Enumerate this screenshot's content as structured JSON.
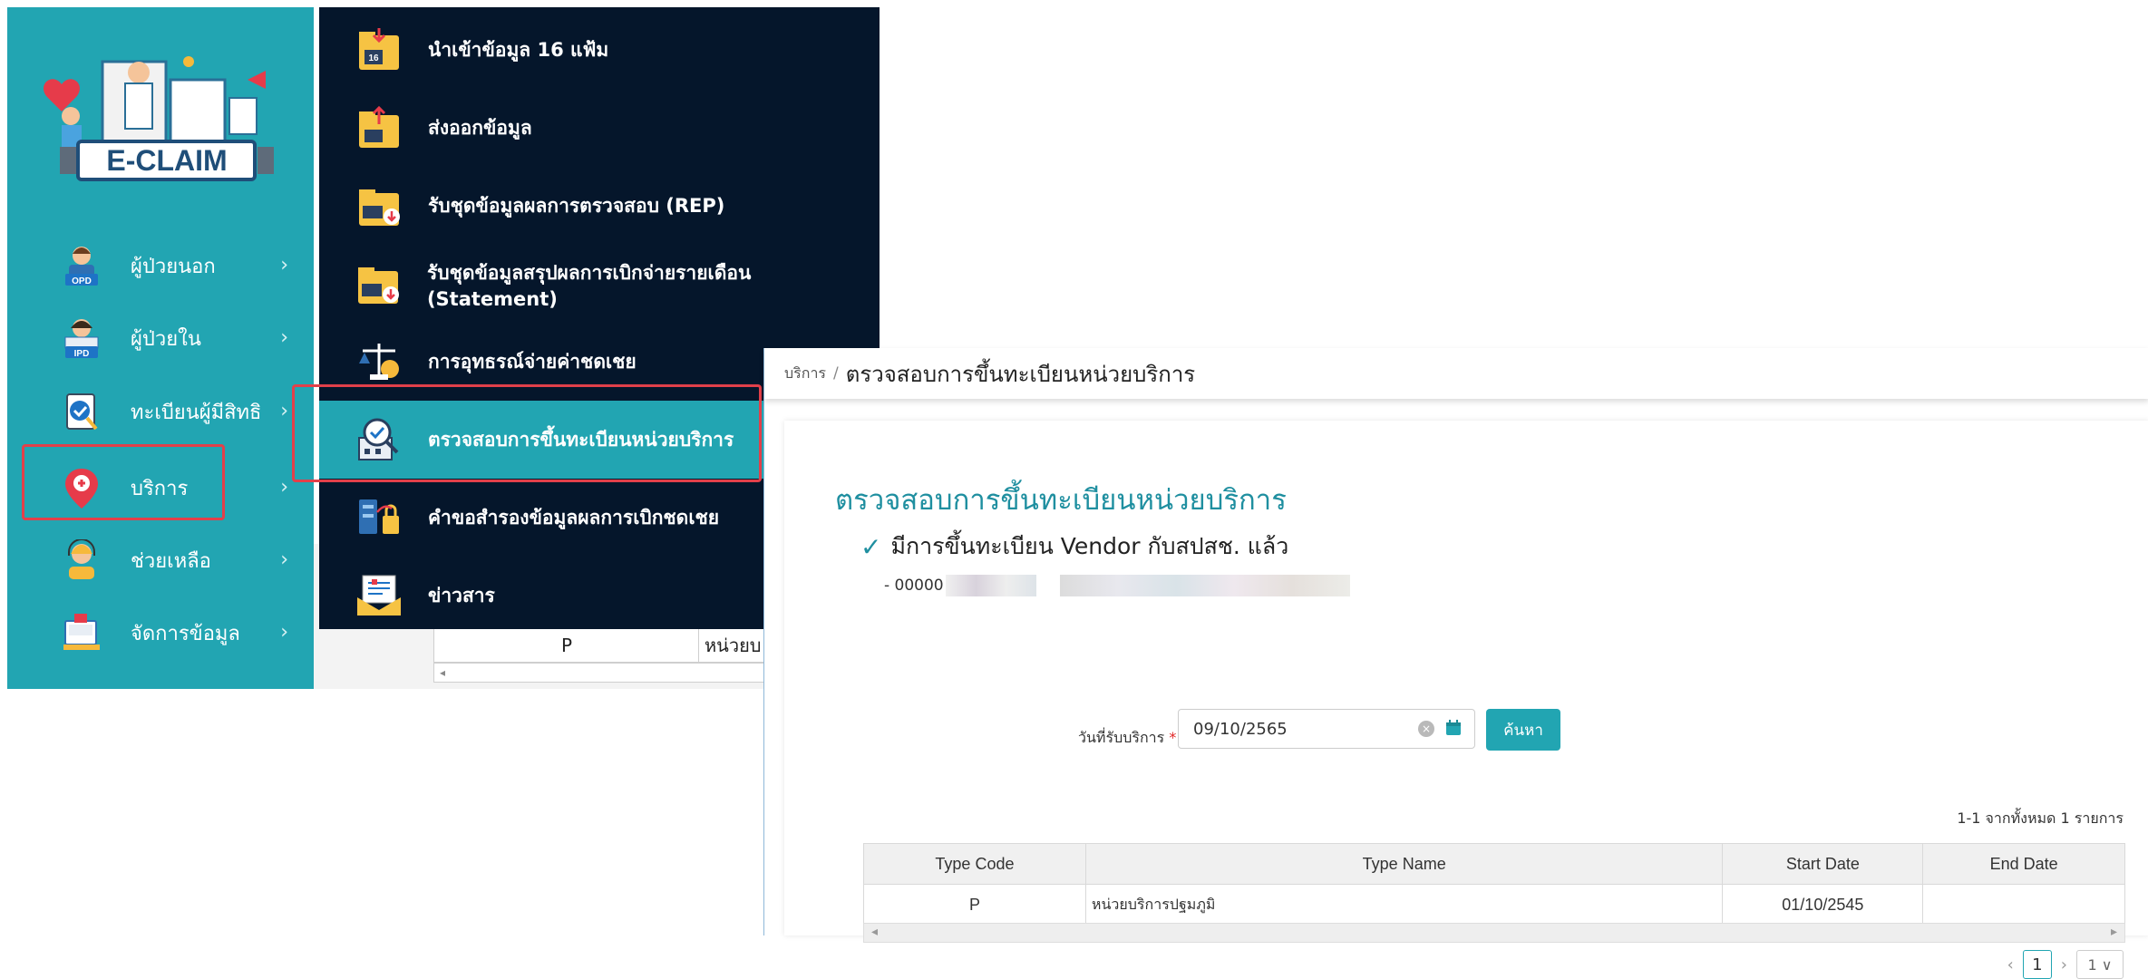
{
  "sidebar": {
    "logo_text": "E-CLAIM",
    "items": [
      {
        "label": "ผู้ป่วยนอก",
        "icon": "opd-patient-icon",
        "badge": "OPD"
      },
      {
        "label": "ผู้ป่วยใน",
        "icon": "ipd-patient-icon",
        "badge": "IPD"
      },
      {
        "label": "ทะเบียนผู้มีสิทธิ",
        "icon": "registry-check-icon"
      },
      {
        "label": "บริการ",
        "icon": "service-pin-icon"
      },
      {
        "label": "ช่วยเหลือ",
        "icon": "help-support-icon"
      },
      {
        "label": "จัดการข้อมูล",
        "icon": "data-manage-icon"
      }
    ],
    "chevron": "›"
  },
  "submenu": {
    "items": [
      {
        "label": "นำเข้าข้อมูล 16 แฟ้ม",
        "icon": "import-folder-icon",
        "badge": "16"
      },
      {
        "label": "ส่งออกข้อมูล",
        "icon": "export-folder-icon"
      },
      {
        "label": "รับชุดข้อมูลผลการตรวจสอบ (REP)",
        "icon": "rep-folder-icon"
      },
      {
        "label": "รับชุดข้อมูลสรุปผลการเบิกจ่ายรายเดือน (Statement)",
        "icon": "statement-folder-icon"
      },
      {
        "label": "การอุทธรณ์จ่ายค่าชดเชย",
        "icon": "scale-icon"
      },
      {
        "label": "ตรวจสอบการขึ้นทะเบียนหน่วยบริการ",
        "icon": "unit-check-icon"
      },
      {
        "label": "คำขอสำรองข้อมูลผลการเบิกชดเชย",
        "icon": "backup-request-icon"
      },
      {
        "label": "ข่าวสาร",
        "icon": "news-icon"
      }
    ]
  },
  "background": {
    "cell_code": "P",
    "cell_name": "หน่วยบ",
    "scroll_left": "◂"
  },
  "main": {
    "breadcrumb": {
      "parent": "บริการ",
      "separator": "/",
      "current": "ตรวจสอบการขึ้นทะเบียนหน่วยบริการ"
    },
    "title": "ตรวจสอบการขึ้นทะเบียนหน่วยบริการ",
    "status": {
      "check": "✓",
      "text": "มีการขึ้นทะเบียน Vendor กับสปสช. แล้ว"
    },
    "vendor_prefix": "- 00000",
    "date_field": {
      "label": "วันที่รับบริการ",
      "required": "*",
      "value": "09/10/2565"
    },
    "search_button": "ค้นหา",
    "count": "1-1 จากทั้งหมด 1 รายการ",
    "table": {
      "columns": [
        "Type Code",
        "Type Name",
        "Start Date",
        "End Date"
      ],
      "rows": [
        [
          "P",
          "หน่วยบริการปฐมภูมิ",
          "01/10/2545",
          ""
        ]
      ]
    },
    "pager": {
      "prev": "‹",
      "page": "1",
      "next": "›",
      "size": "1 ∨"
    }
  },
  "colors": {
    "teal": "#22a5b2",
    "navy": "#05162b",
    "highlight": "#e2404a",
    "title": "#1f8fa0"
  }
}
